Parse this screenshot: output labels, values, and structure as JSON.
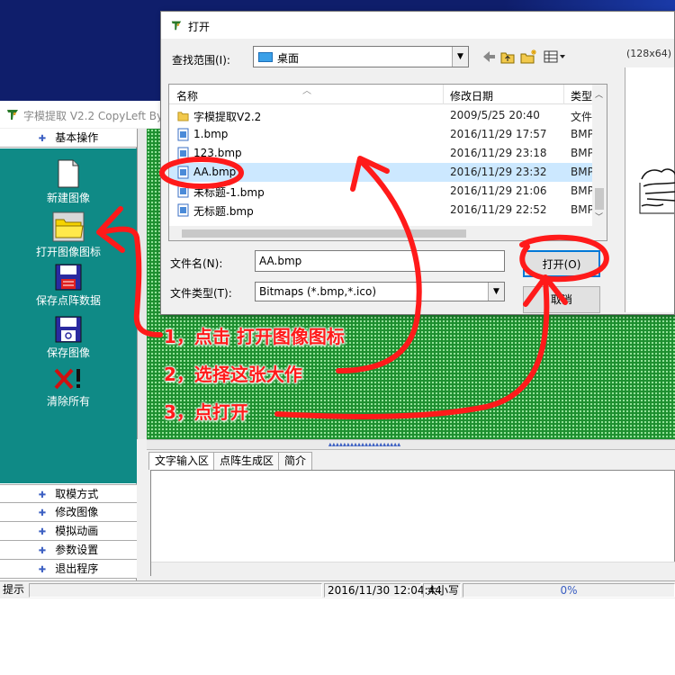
{
  "app": {
    "title": "字模提取 V2.2  CopyLeft By",
    "sections": {
      "basic_ops": "基本操作",
      "bottom": [
        "取模方式",
        "修改图像",
        "模拟动画",
        "参数设置",
        "退出程序"
      ]
    },
    "tools": [
      {
        "label": "新建图像",
        "icon": "new-file-icon"
      },
      {
        "label": "打开图像图标",
        "icon": "open-folder-icon"
      },
      {
        "label": "保存点阵数据",
        "icon": "save-data-icon"
      },
      {
        "label": "保存图像",
        "icon": "save-image-icon"
      },
      {
        "label": "清除所有",
        "icon": "clear-all-icon"
      }
    ],
    "tabs": [
      "文字输入区",
      "点阵生成区",
      "简介"
    ],
    "statusbar": {
      "hint": "提示",
      "datetime": "2016/11/30 12:04:44",
      "case": "大小写",
      "progress": "0%"
    }
  },
  "dialog": {
    "title": "打开",
    "lookin_label": "查找范围(I):",
    "lookin_value": "桌面",
    "preview_size": "(128x64)",
    "columns": {
      "name": "名称",
      "date": "修改日期",
      "type": "类型"
    },
    "files": [
      {
        "name": "字模提取V2.2",
        "date": "2009/5/25 20:40",
        "type": "文件",
        "kind": "folder"
      },
      {
        "name": "1.bmp",
        "date": "2016/11/29 17:57",
        "type": "BMP",
        "kind": "bmp"
      },
      {
        "name": "123.bmp",
        "date": "2016/11/29 23:18",
        "type": "BMP",
        "kind": "bmp"
      },
      {
        "name": "AA.bmp",
        "date": "2016/11/29 23:32",
        "type": "BMP",
        "kind": "bmp",
        "selected": true
      },
      {
        "name": "未标题-1.bmp",
        "date": "2016/11/29 21:06",
        "type": "BMP",
        "kind": "bmp"
      },
      {
        "name": "无标题.bmp",
        "date": "2016/11/29 22:52",
        "type": "BMP",
        "kind": "bmp"
      }
    ],
    "filename_label": "文件名(N):",
    "filename_value": "AA.bmp",
    "filetype_label": "文件类型(T):",
    "filetype_value": "Bitmaps (*.bmp,*.ico)",
    "open_button": "打开(O)",
    "cancel_button": "取消"
  },
  "annotations": [
    "1，点击 打开图像图标",
    "2，选择这张大作",
    "3，点打开"
  ],
  "colors": {
    "desktop": "#0f1e6b",
    "teal": "#0f8a86",
    "grid_green": "#1d8f2f",
    "annotation_red": "#ff1a1a",
    "selection": "#cce8ff"
  }
}
